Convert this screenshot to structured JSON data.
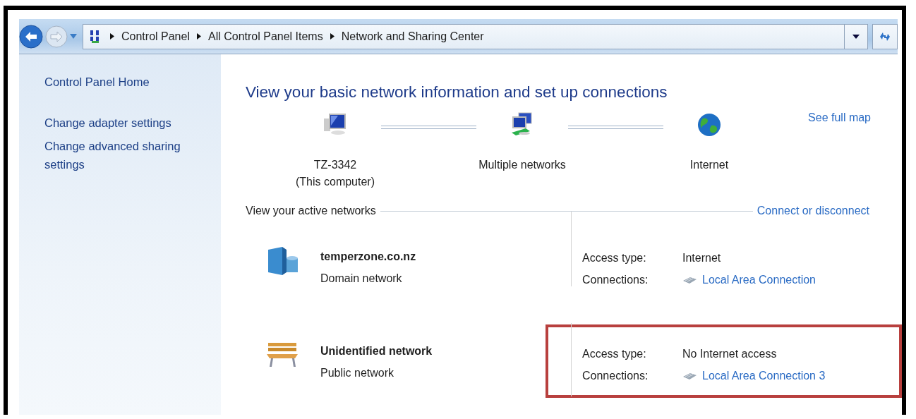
{
  "breadcrumbs": [
    "Control Panel",
    "All Control Panel Items",
    "Network and Sharing Center"
  ],
  "sidebar": {
    "items": [
      "Control Panel Home",
      "Change adapter settings",
      "Change advanced sharing settings"
    ]
  },
  "heading": "View your basic network information and set up connections",
  "map": {
    "nodes": [
      {
        "kind": "computer",
        "label": "TZ-3342",
        "sublabel": "(This computer)"
      },
      {
        "kind": "networks",
        "label": "Multiple networks"
      },
      {
        "kind": "internet",
        "label": "Internet"
      }
    ],
    "link": "See full map"
  },
  "active_networks": {
    "title": "View your active networks",
    "link": "Connect or disconnect"
  },
  "networks": [
    {
      "kind": "domain",
      "name": "temperzone.co.nz",
      "type": "Domain network",
      "access_label": "Access type:",
      "access": "Internet",
      "connections_label": "Connections:",
      "connection": "Local Area Connection",
      "highlighted": false
    },
    {
      "kind": "public",
      "name": "Unidentified network",
      "type": "Public network",
      "access_label": "Access type:",
      "access": "No Internet access",
      "connections_label": "Connections:",
      "connection": "Local Area Connection 3",
      "highlighted": true
    }
  ]
}
